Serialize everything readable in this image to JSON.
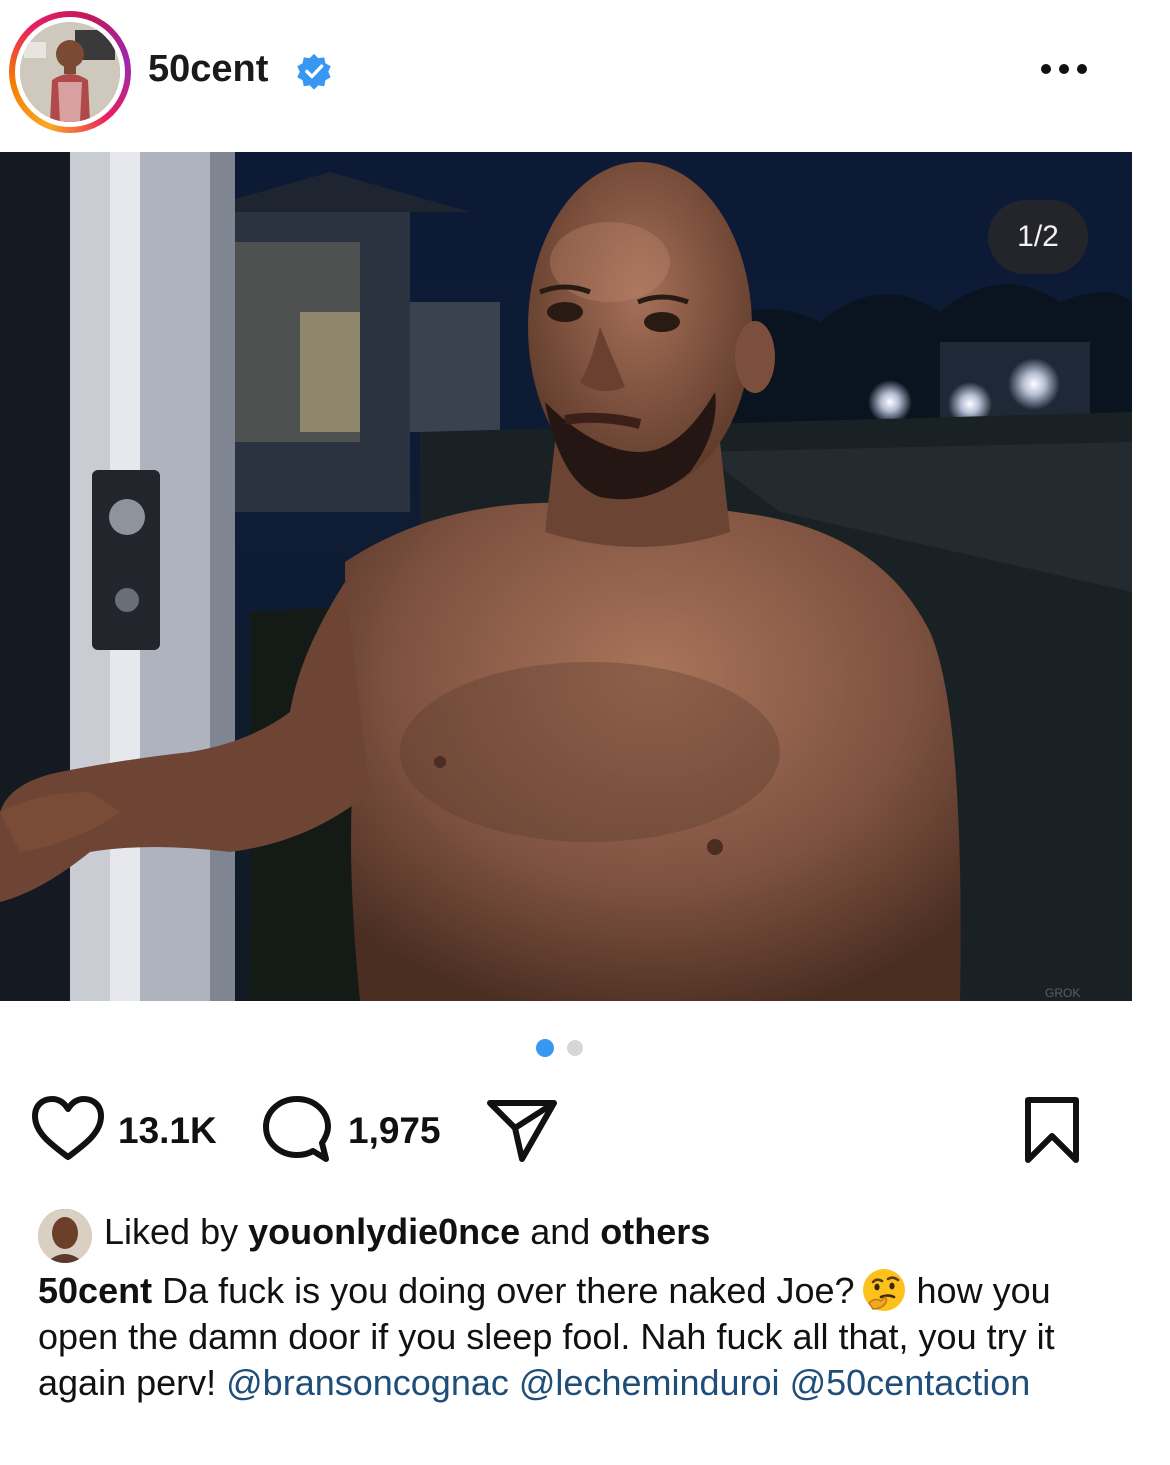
{
  "post": {
    "username": "50cent",
    "verified": true,
    "more_icon": "more-horizontal-icon",
    "carousel_counter": "1/2",
    "carousel_total": 2,
    "carousel_index": 1
  },
  "actions": {
    "likes": "13.1K",
    "comments": "1,975",
    "like_icon": "heart-icon",
    "comment_icon": "comment-icon",
    "share_icon": "send-icon",
    "save_icon": "bookmark-icon"
  },
  "liked_by": {
    "prefix": "Liked by",
    "user": "youonlydie0nce",
    "middle": "and",
    "others": "others"
  },
  "caption": {
    "username": "50cent",
    "text_1": "Da fuck is you doing over there naked Joe?",
    "emoji": "thinking-face-emoji",
    "text_2": "how you open the damn door if you sleep fool. Nah fuck all that, you try it again perv!",
    "mention_1": "@bransoncognac",
    "mention_2": "@lecheminduroi",
    "mention_3": "@50centaction"
  },
  "colors": {
    "accent_blue": "#3897f0",
    "mention_blue": "#1f4e79",
    "dot_inactive": "#d6d6d6"
  }
}
